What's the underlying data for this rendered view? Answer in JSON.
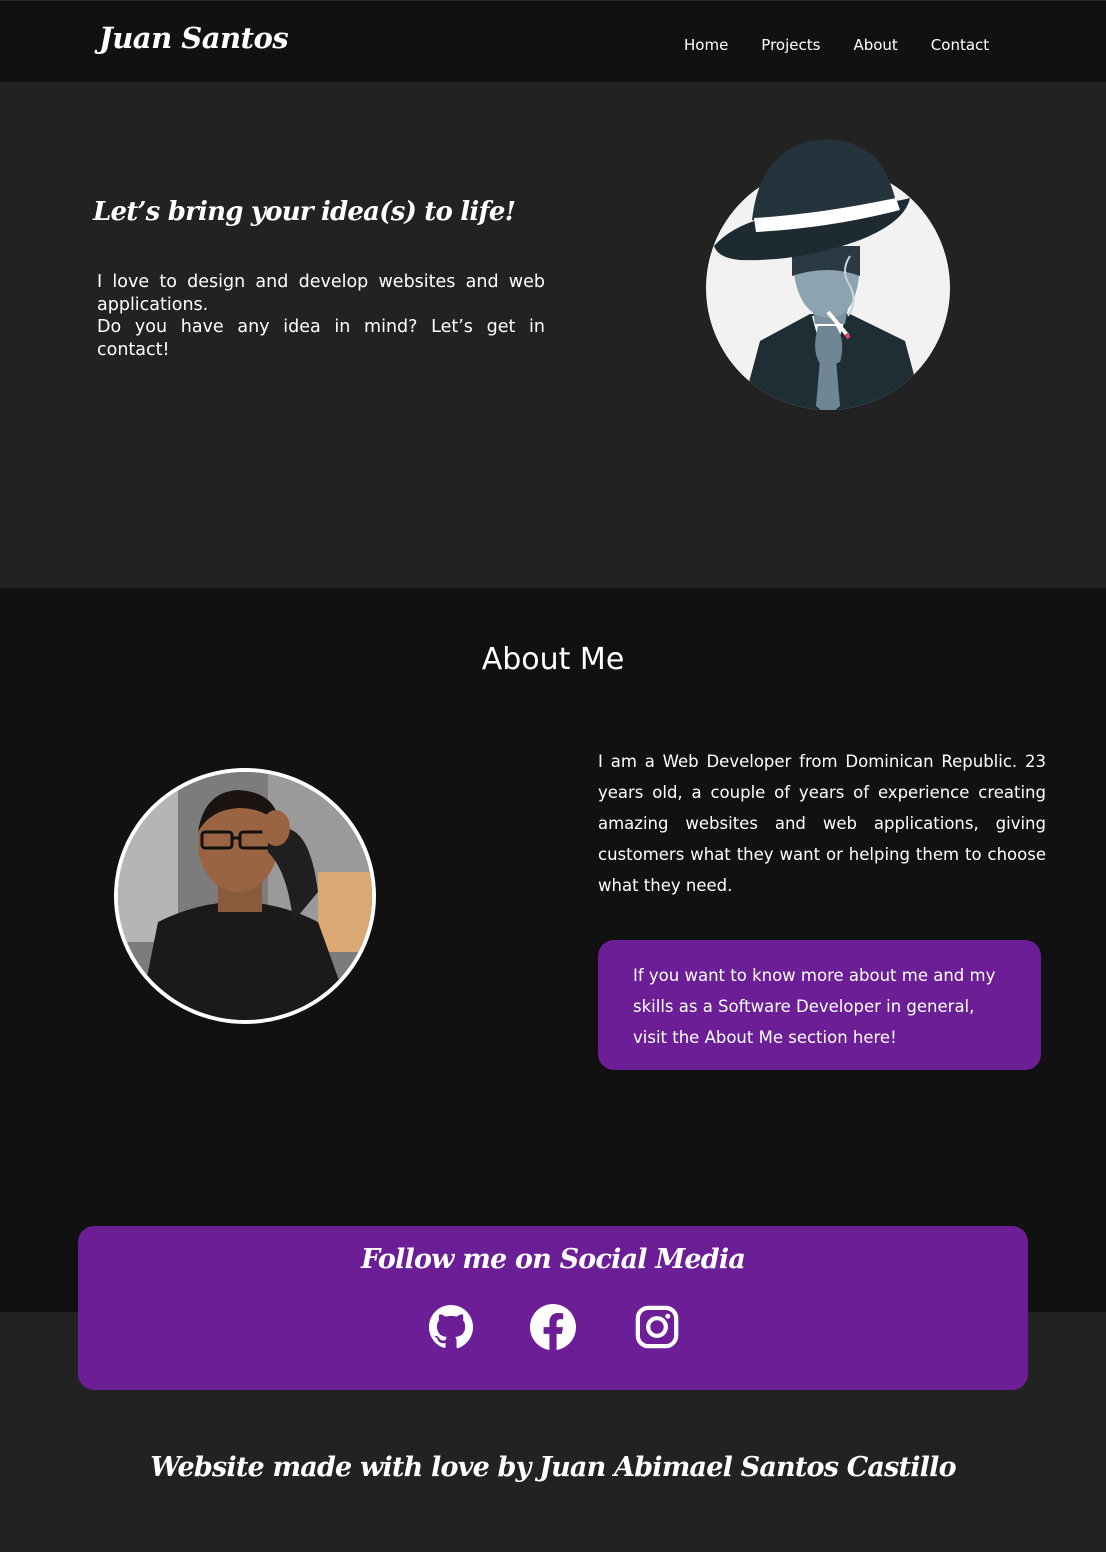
{
  "nav": {
    "brand": "Juan Santos",
    "links": [
      {
        "label": "Home"
      },
      {
        "label": "Projects"
      },
      {
        "label": "About"
      },
      {
        "label": "Contact"
      }
    ]
  },
  "hero": {
    "title": "Let’s bring your idea(s) to life!",
    "paragraph_1": "I love to design and develop websites and web applications.",
    "paragraph_2": "Do you have any idea in mind? Let’s get in contact!"
  },
  "about": {
    "title": "About Me",
    "description": "I am a Web Developer from Dominican Republic. 23 years old, a couple of years of experience creating amazing websites and web applications, giving customers what they want or helping them to choose what they need.",
    "card_text": "If you want to know more about me and my skills as a Software Developer in general, visit the About Me section here!"
  },
  "social": {
    "title": "Follow me on Social Media",
    "icons": [
      "github-icon",
      "facebook-icon",
      "instagram-icon"
    ]
  },
  "footer": {
    "text": "Website made with love by Juan Abimael Santos Castillo"
  },
  "colors": {
    "nav_bg": "#111111",
    "page_bg": "#222222",
    "accent_purple": "#6b1e95",
    "text": "#ffffff"
  }
}
